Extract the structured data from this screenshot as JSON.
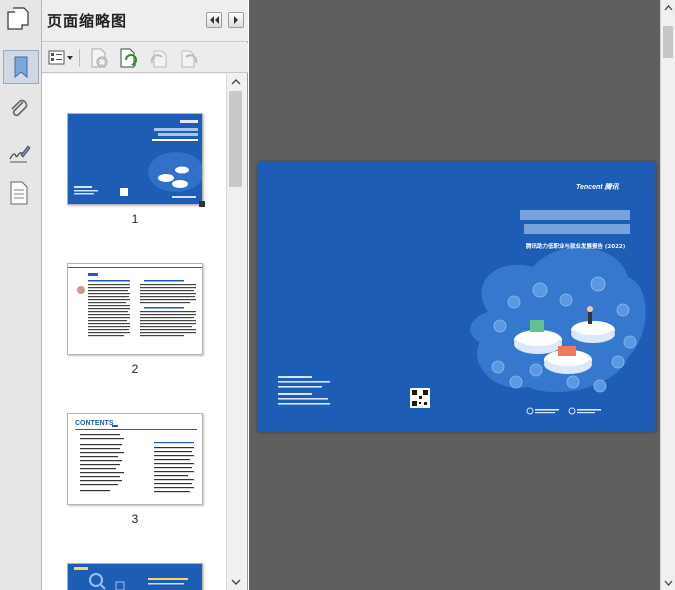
{
  "panel": {
    "title": "页面缩略图"
  },
  "thumbnails": [
    {
      "label": "1"
    },
    {
      "label": "2"
    },
    {
      "label": "3"
    }
  ],
  "thumb3": {
    "heading": "CONTENTS"
  },
  "cover": {
    "brand": "Tencent 腾讯",
    "subtitle": "腾讯助力低职业与就业发展报告 (2022)"
  },
  "icons": {
    "rail": [
      "pages-icon",
      "paperclip-icon",
      "signature-icon",
      "document-icon"
    ],
    "toolbar": [
      "thumbnail-options-icon",
      "delete-page-icon",
      "rotate-page-icon",
      "disabled-icon",
      "disabled-icon"
    ]
  },
  "colors": {
    "cover_blue": "#1d5db5",
    "viewer_bg": "#5f5f5f",
    "panel_bg": "#f2f2f2"
  }
}
